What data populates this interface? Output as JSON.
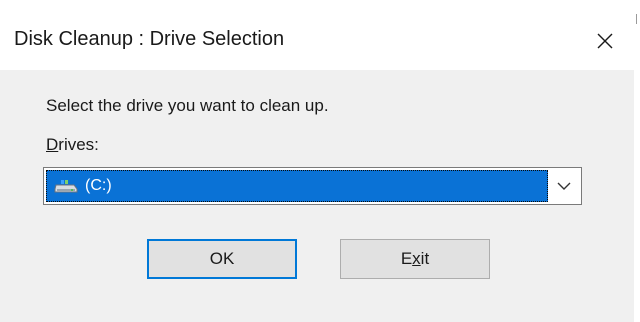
{
  "window": {
    "title": "Disk Cleanup : Drive Selection",
    "close_icon": "close-icon"
  },
  "content": {
    "instruction": "Select the drive you want to clean up.",
    "drives_label_accel": "D",
    "drives_label_rest": "rives:"
  },
  "drive_select": {
    "selected_value": "(C:)",
    "icon": "drive-icon",
    "highlight_color": "#0a72d6"
  },
  "buttons": {
    "ok_label": "OK",
    "exit_label_pre": "E",
    "exit_label_accel": "x",
    "exit_label_post": "it"
  }
}
